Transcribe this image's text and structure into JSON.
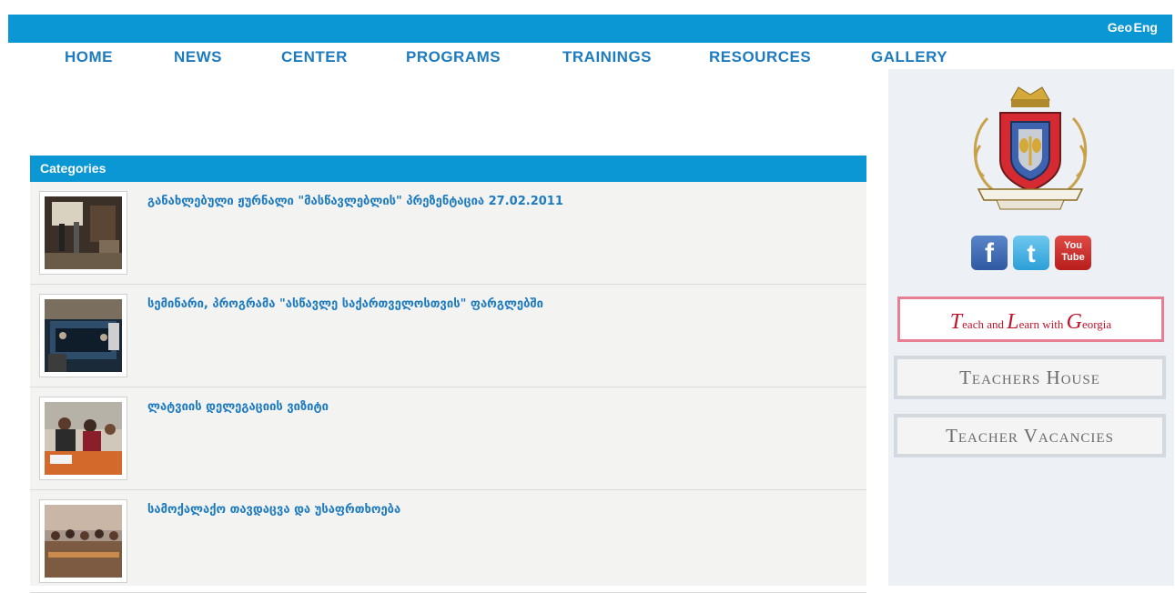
{
  "header": {
    "lang_geo": "Geo",
    "lang_eng": "Eng"
  },
  "nav": {
    "items": [
      "HOME",
      "NEWS",
      "CENTER",
      "PROGRAMS",
      "TRAININGS",
      "RESOURCES",
      "GALLERY"
    ]
  },
  "categories": {
    "title": "Categories",
    "items": [
      {
        "title": "განახლებული ჟურნალი \"მასწავლებლის\" პრეზენტაცია 27.02.2011"
      },
      {
        "title": "სემინარი, პროგრამა \"ასწავლე საქართველოსთვის\" ფარგლებში"
      },
      {
        "title": "ლატვიის დელეგაციის ვიზიტი"
      },
      {
        "title": "სამოქალაქო თავდაცვა და უსაფრთხოება"
      }
    ]
  },
  "sidebar": {
    "social": {
      "facebook": "f",
      "twitter": "t",
      "youtube_top": "You",
      "youtube_bottom": "Tube"
    },
    "teach_learn": {
      "t_initial": "T",
      "t_rest": "each and ",
      "l_initial": "L",
      "l_rest": "earn with ",
      "g_initial": "G",
      "g_rest": "eorgia"
    },
    "teachers_house": "Teachers House",
    "teacher_vacancies": "Teacher Vacancies"
  },
  "colors": {
    "accent": "#0a97d4",
    "nav_text": "#1e7bbf",
    "sidebar_bg": "#edf0f5",
    "list_bg": "#f3f3f2"
  }
}
